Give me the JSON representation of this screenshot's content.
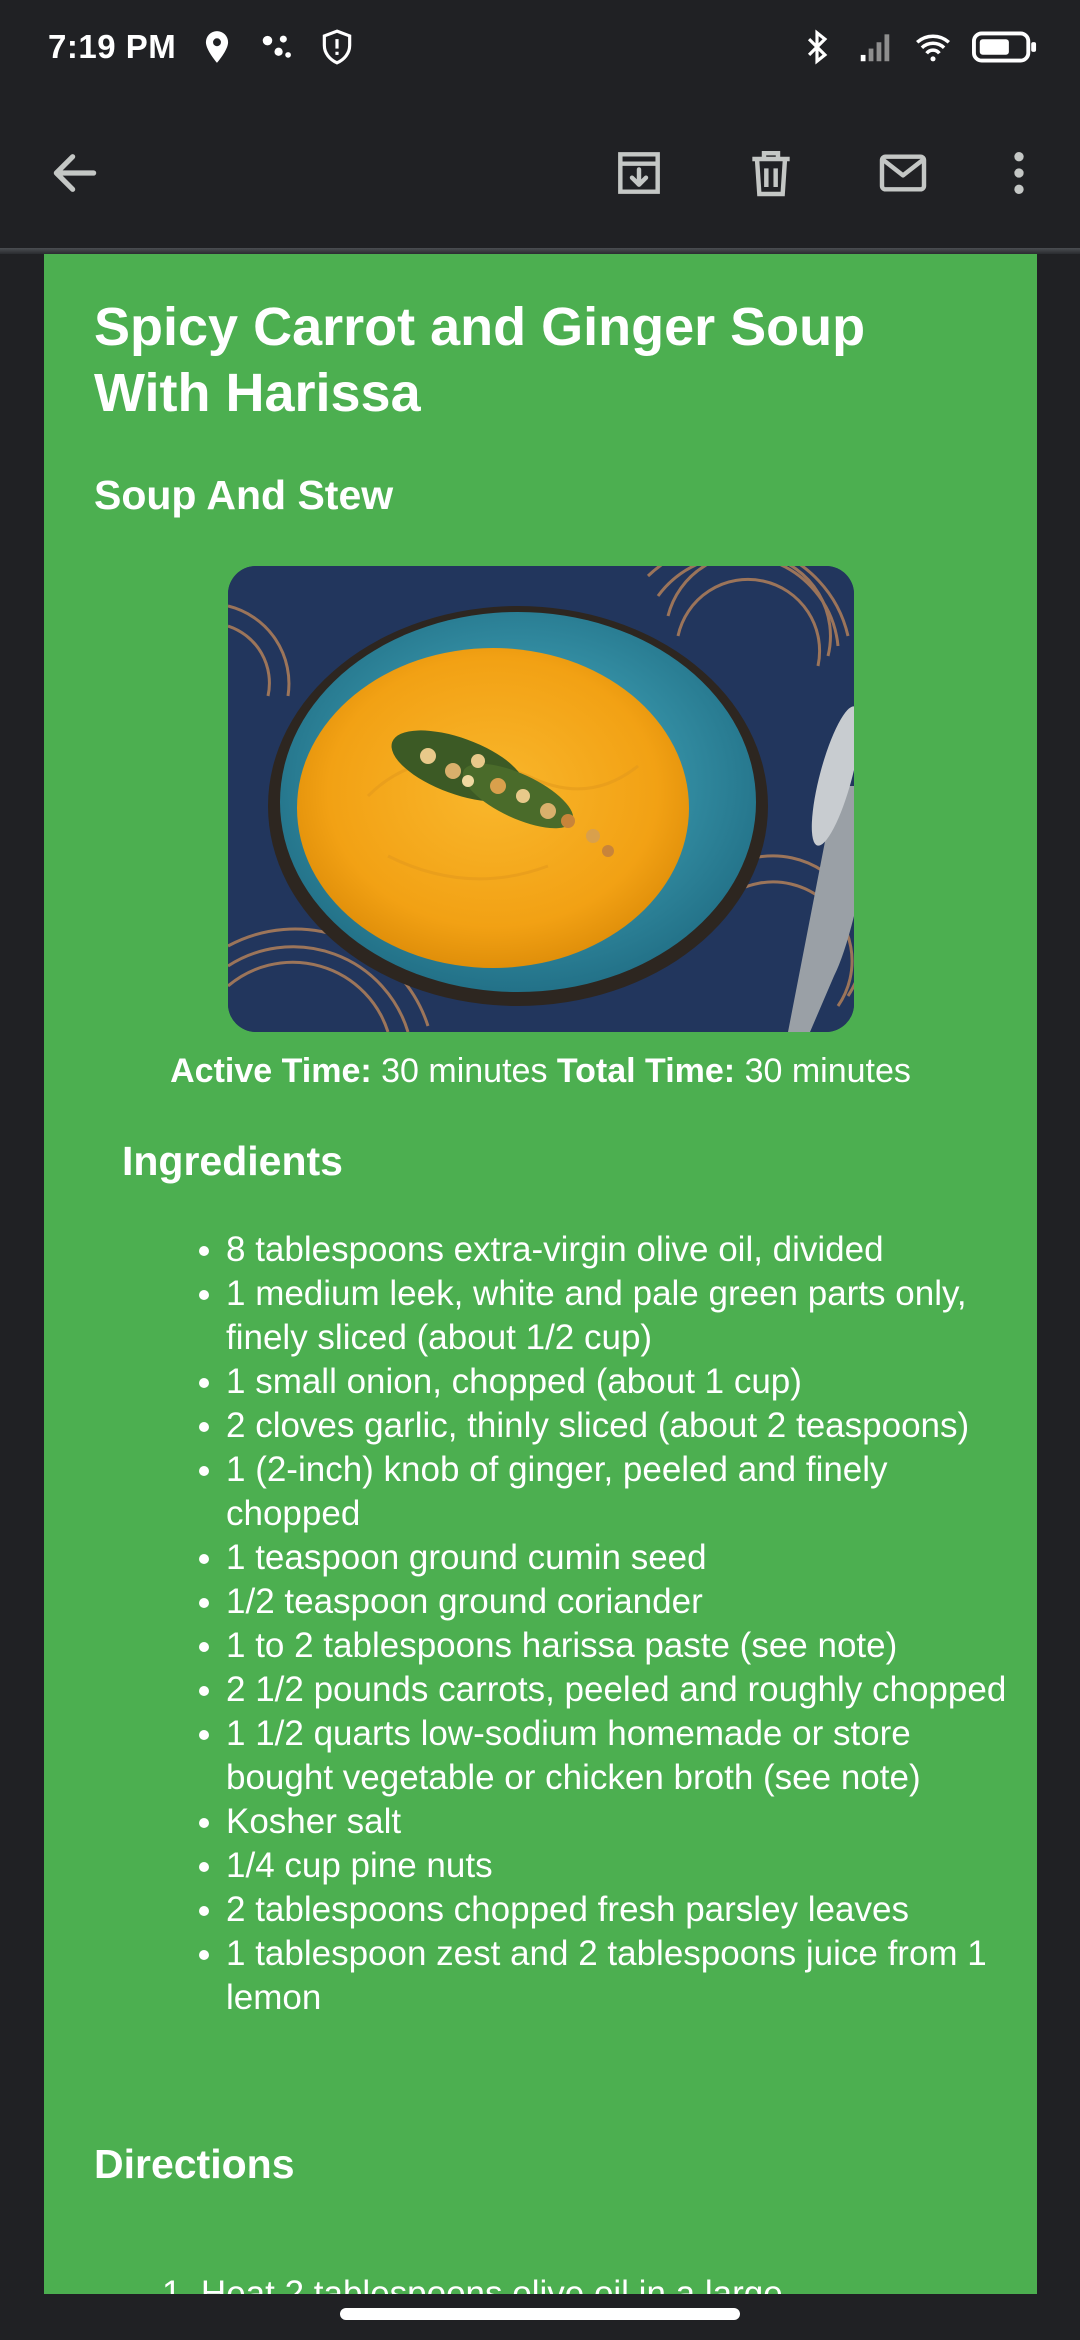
{
  "status_bar": {
    "time": "7:19 PM",
    "left_icons": [
      "location-icon",
      "assistant-dots-icon",
      "shield-icon"
    ],
    "right_icons": [
      "bluetooth-icon",
      "cellular-signal-icon",
      "wifi-icon",
      "battery-icon"
    ]
  },
  "app_bar": {
    "back_icon": "arrow-back-icon",
    "actions": [
      "archive-icon",
      "delete-icon",
      "mark-unread-icon",
      "more-vert-icon"
    ]
  },
  "email": {
    "background_color": "#4caf50",
    "title": "Spicy Carrot and Ginger Soup With Harissa",
    "category": "Soup And Stew",
    "photo_icon": "soup-bowl-photo",
    "active_time_label": "Active Time:",
    "active_time_value": "30 minutes",
    "total_time_label": "Total Time:",
    "total_time_value": "30 minutes",
    "ingredients_heading": "Ingredients",
    "ingredients": [
      "8 tablespoons extra-virgin olive oil, divided",
      "1 medium leek, white and pale green parts only, finely sliced (about 1/2 cup)",
      "1 small onion, chopped (about 1 cup)",
      "2 cloves garlic, thinly sliced (about 2 teaspoons)",
      "1 (2-inch) knob of ginger, peeled and finely chopped",
      "1 teaspoon ground cumin seed",
      "1/2 teaspoon ground coriander",
      "1 to 2 tablespoons harissa paste (see note)",
      "2 1/2 pounds carrots, peeled and roughly chopped",
      "1 1/2 quarts low-sodium homemade or store bought vegetable or chicken broth (see note)",
      "Kosher salt",
      "1/4 cup pine nuts",
      "2 tablespoons chopped fresh parsley leaves",
      "1 tablespoon zest and 2 tablespoons juice from 1 lemon"
    ],
    "directions_heading": "Directions",
    "first_direction_partial": "1.  Heat 2 tablespoons olive oil in a large"
  }
}
